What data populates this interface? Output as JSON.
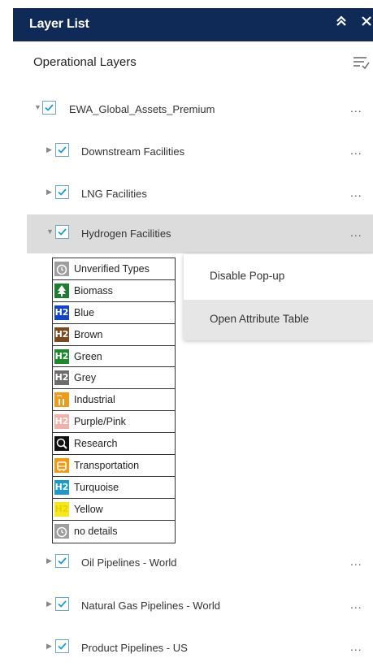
{
  "header": {
    "title": "Layer List",
    "collapse_icon": "double-chevron-up-icon",
    "close_icon": "close-icon"
  },
  "section": {
    "title": "Operational Layers",
    "filter_icon": "sort-filter-icon"
  },
  "layers": [
    {
      "label": "EWA_Global_Assets_Premium",
      "expanded": true,
      "checked": true
    },
    {
      "label": "Downstream Facilities",
      "expanded": false,
      "checked": true
    },
    {
      "label": "LNG Facilities",
      "expanded": false,
      "checked": true
    },
    {
      "label": "Hydrogen Facilities",
      "expanded": true,
      "checked": true
    },
    {
      "label": "Oil Pipelines - World",
      "expanded": false,
      "checked": true
    },
    {
      "label": "Natural Gas Pipelines - World",
      "expanded": false,
      "checked": true
    },
    {
      "label": "Product Pipelines - US",
      "expanded": false,
      "checked": true
    }
  ],
  "more_label": "...",
  "legend": [
    {
      "label": "Unverified Types",
      "color": "#9e9e9e",
      "symbol": "clock"
    },
    {
      "label": "Biomass",
      "color": "#1a7f2e",
      "symbol": "tree"
    },
    {
      "label": "Blue",
      "color": "#1244c8",
      "symbol": "H2"
    },
    {
      "label": "Brown",
      "color": "#7a4a1e",
      "symbol": "H2"
    },
    {
      "label": "Green",
      "color": "#1f8a2a",
      "symbol": "H2"
    },
    {
      "label": "Grey",
      "color": "#6d6d6d",
      "symbol": "H2"
    },
    {
      "label": "Industrial",
      "color": "#f39a14",
      "symbol": "factory"
    },
    {
      "label": "Purple/Pink",
      "color": "#f3b0a8",
      "symbol": "H2"
    },
    {
      "label": "Research",
      "color": "#111111",
      "symbol": "search"
    },
    {
      "label": "Transportation",
      "color": "#f39a14",
      "symbol": "bus"
    },
    {
      "label": "Turquoise",
      "color": "#1a9bd0",
      "symbol": "H2"
    },
    {
      "label": "Yellow",
      "color": "#f6e81a",
      "symbol": "H2"
    },
    {
      "label": "no details",
      "color": "#9e9e9e",
      "symbol": "clock"
    }
  ],
  "menu": [
    {
      "label": "Disable Pop-up"
    },
    {
      "label": "Open Attribute Table"
    }
  ],
  "colors": {
    "header_bg": "#0f2a57",
    "checkbox": "#1a9bd0",
    "selected_row": "#dcdcdc"
  }
}
